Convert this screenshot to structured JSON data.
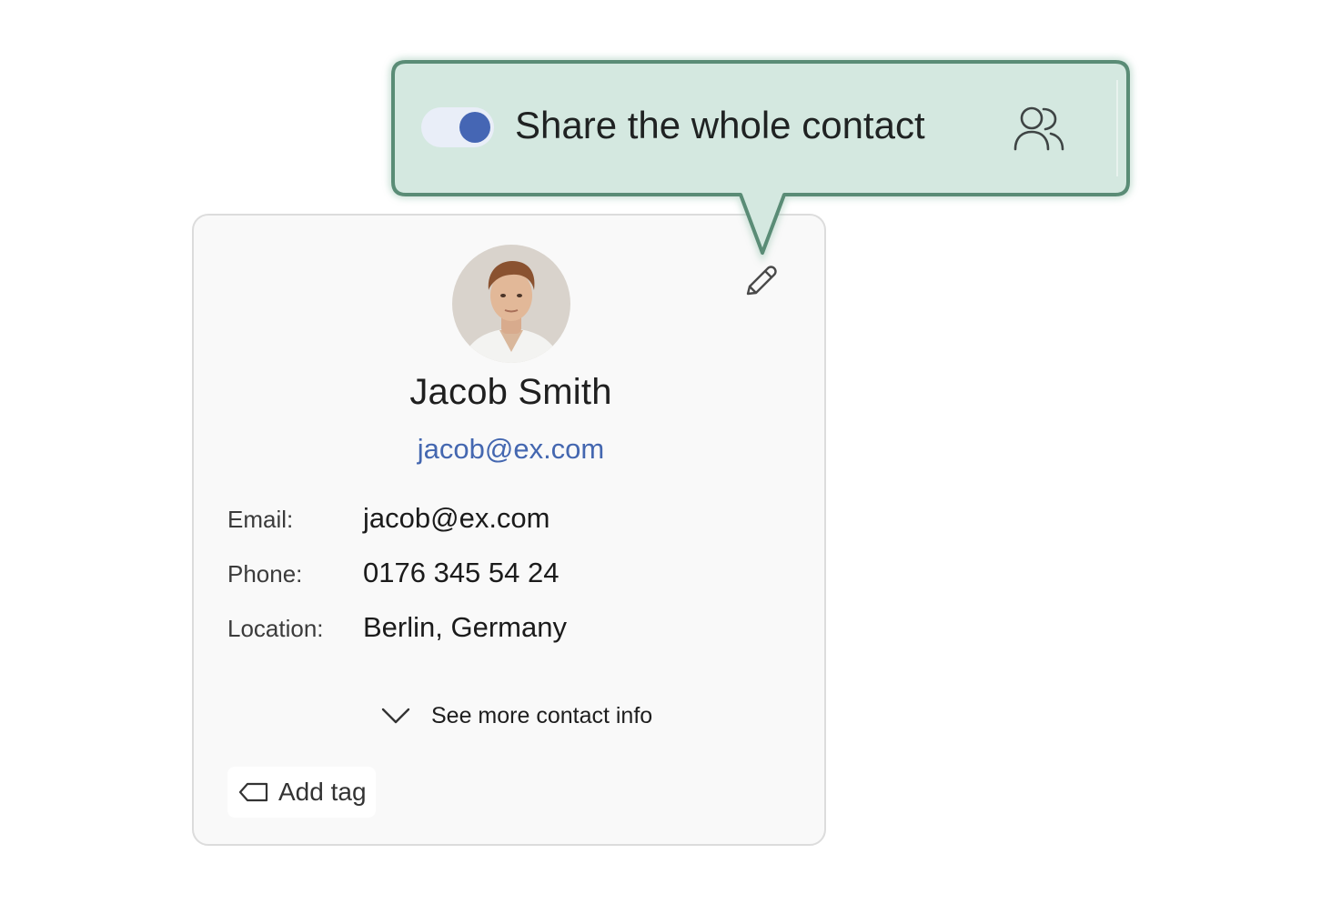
{
  "contact": {
    "name": "Jacob Smith",
    "email_link": "jacob@ex.com",
    "details": [
      {
        "label": "Email:",
        "value": "jacob@ex.com"
      },
      {
        "label": "Phone:",
        "value": "0176 345 54 24"
      },
      {
        "label": "Location:",
        "value": "Berlin, Germany"
      }
    ],
    "see_more_label": "See more contact info",
    "add_tag_label": "Add tag"
  },
  "callout": {
    "text": "Share the whole contact",
    "toggle_on": true
  },
  "icons": {
    "edit": "pencil-icon",
    "see_more": "chevron-down-icon",
    "tag": "tag-icon",
    "share": "people-icon"
  },
  "colors": {
    "accent": "#4566b4",
    "link": "#4467b0",
    "callout_bg": "#d4e8e0",
    "callout_border": "#5a8c76",
    "card_bg": "#f9f9f9"
  }
}
